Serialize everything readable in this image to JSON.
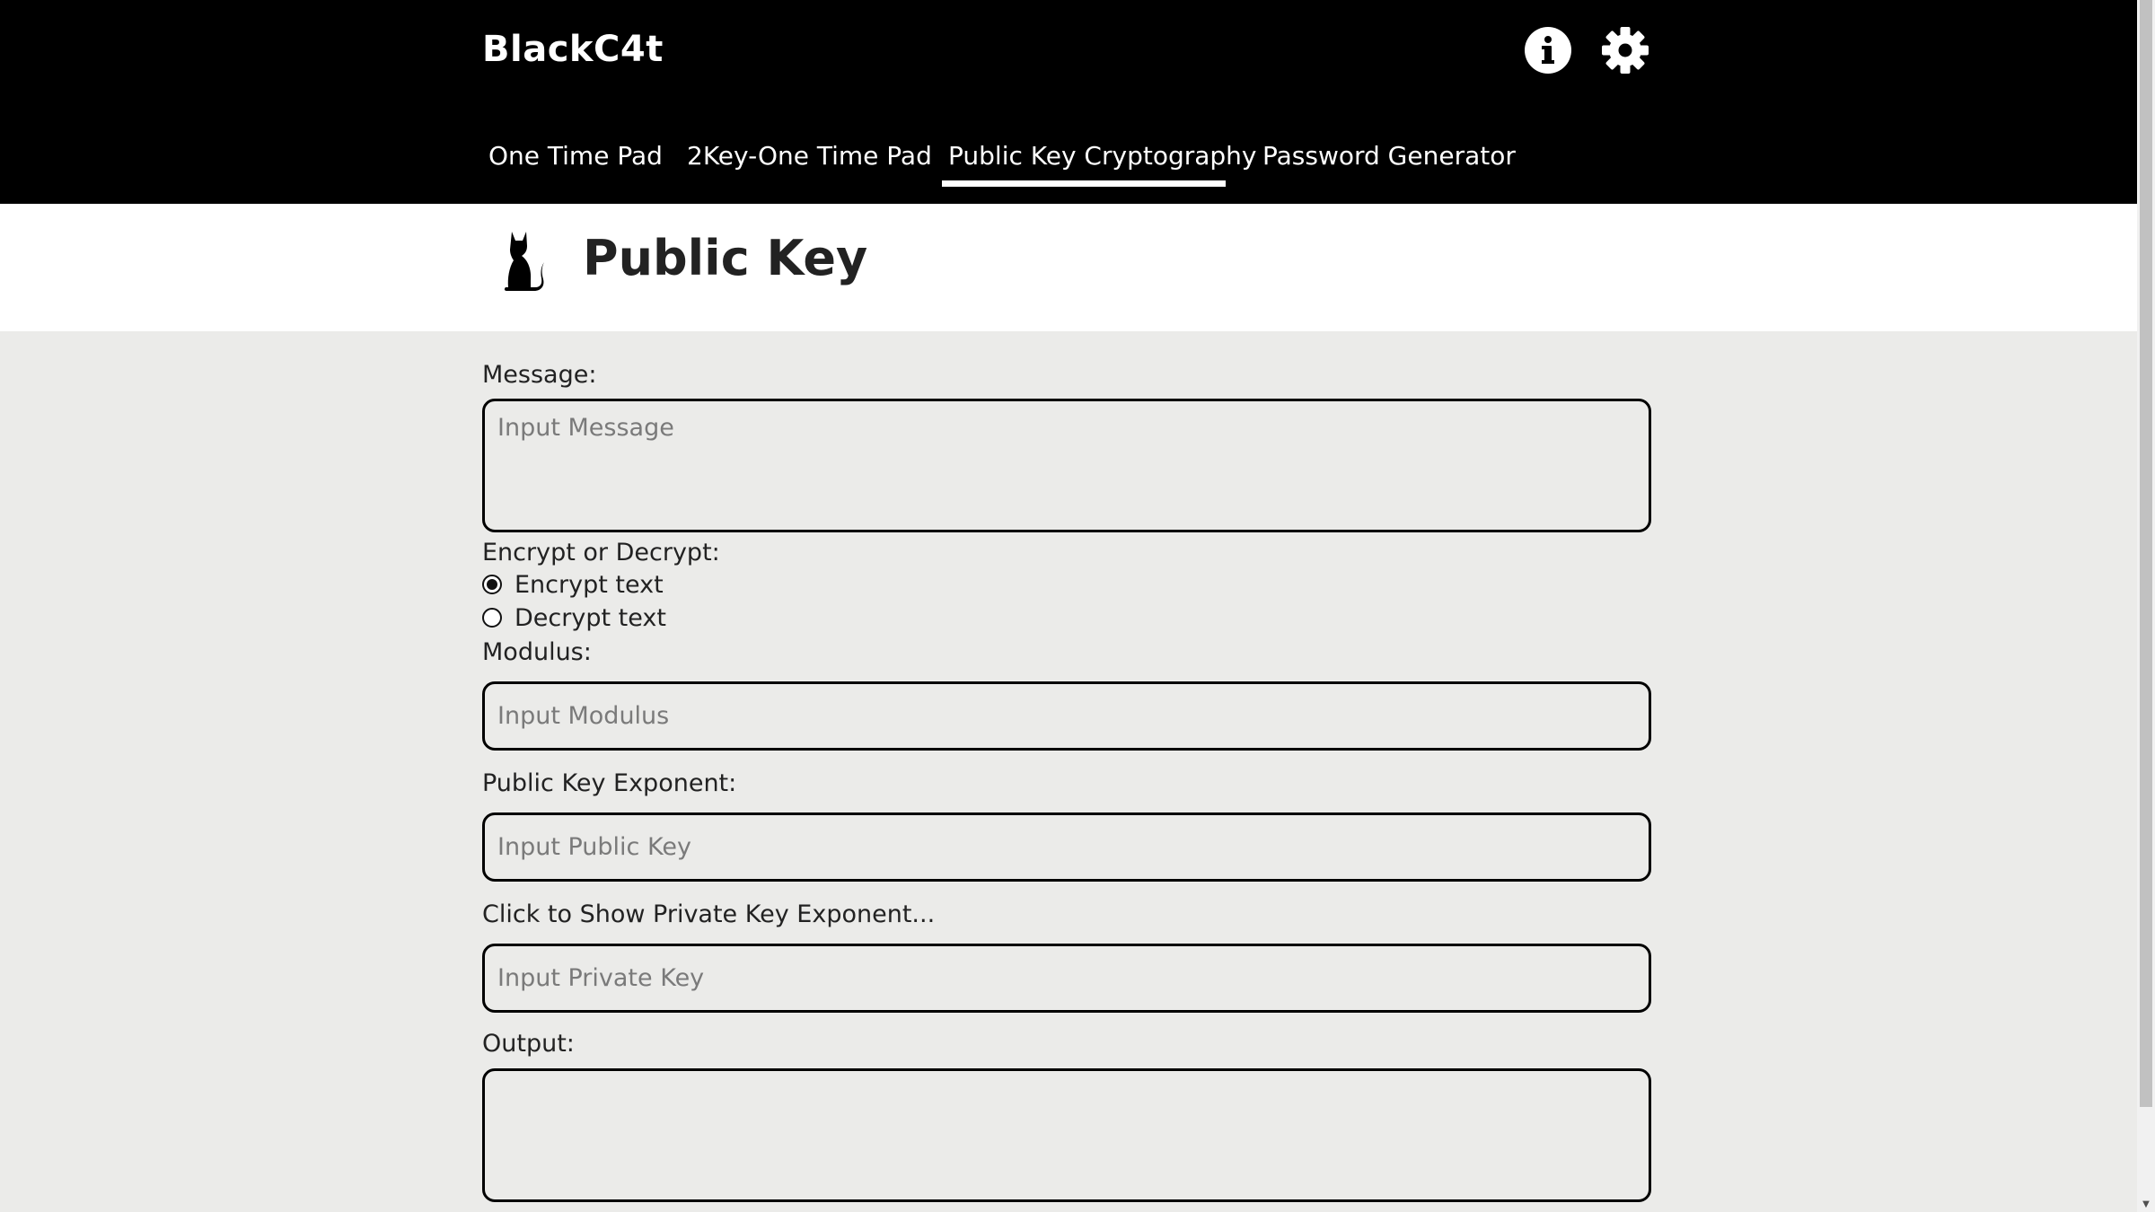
{
  "header": {
    "brand": "BlackC4t",
    "icons": [
      "info-icon",
      "gear-icon"
    ],
    "tabs": [
      {
        "label": "One Time Pad"
      },
      {
        "label": "2Key-One Time Pad"
      },
      {
        "label": "Public Key Cryptography",
        "active": true
      },
      {
        "label": "Password Generator"
      }
    ]
  },
  "page": {
    "title": "Public Key",
    "logo_icon": "cat-icon"
  },
  "form": {
    "message_label": "Message:",
    "message_placeholder": "Input Message",
    "mode_label": "Encrypt or Decrypt:",
    "mode_options": [
      {
        "label": "Encrypt text",
        "selected": true
      },
      {
        "label": "Decrypt text",
        "selected": false
      }
    ],
    "modulus_label": "Modulus:",
    "modulus_placeholder": "Input Modulus",
    "public_key_label": "Public Key Exponent:",
    "public_key_placeholder": "Input Public Key",
    "private_key_toggle": "Click to Show Private Key Exponent...",
    "private_key_placeholder": "Input Private Key",
    "output_label": "Output:",
    "output_value": ""
  },
  "colors": {
    "header_bg": "#000000",
    "page_bg": "#ebebe9",
    "title_band_bg": "#ffffff",
    "text": "#222222"
  }
}
